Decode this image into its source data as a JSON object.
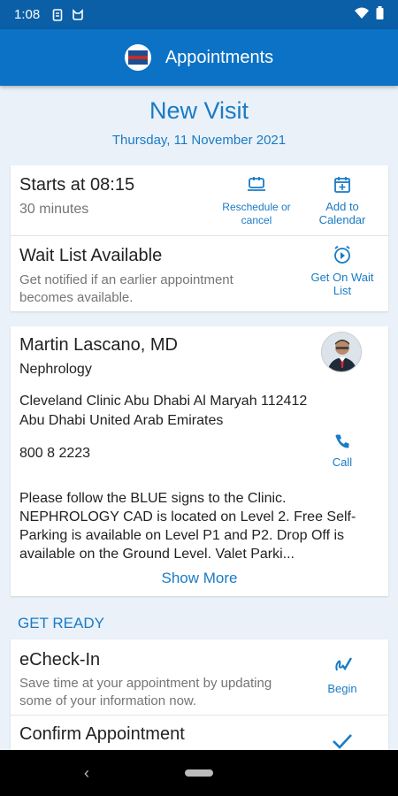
{
  "status_bar": {
    "time": "1:08"
  },
  "header": {
    "title": "Appointments"
  },
  "visit": {
    "title": "New Visit",
    "date": "Thursday, 11 November 2021"
  },
  "schedule": {
    "start": "Starts at 08:15",
    "duration": "30 minutes",
    "reschedule_label": "Reschedule or cancel",
    "calendar_label": "Add to Calendar"
  },
  "waitlist": {
    "title": "Wait List Available",
    "description": "Get notified if an earlier appointment becomes available.",
    "action_label": "Get On Wait List"
  },
  "provider": {
    "name": "Martin Lascano, MD",
    "specialty": "Nephrology",
    "address_line1": "Cleveland Clinic Abu Dhabi Al Maryah 112412",
    "address_line2": "Abu Dhabi United Arab Emirates",
    "phone": "800 8 2223",
    "call_label": "Call",
    "directions": "Please follow the BLUE signs to the Clinic. NEPHROLOGY CAD is located on  Level 2. Free Self-Parking is available on Level P1 and P2. Drop Off is  available on the Ground Level. Valet Parki...",
    "show_more": "Show More"
  },
  "get_ready": {
    "header": "GET READY",
    "echeckin": {
      "title": "eCheck-In",
      "description": "Save time at your appointment by updating some of your information now.",
      "action_label": "Begin"
    },
    "confirm": {
      "title": "Confirm Appointment"
    }
  },
  "colors": {
    "accent": "#1a7bc4",
    "app_bar": "#0b72c6",
    "status_bar": "#0a5fa6",
    "background": "#eaf1f9"
  }
}
